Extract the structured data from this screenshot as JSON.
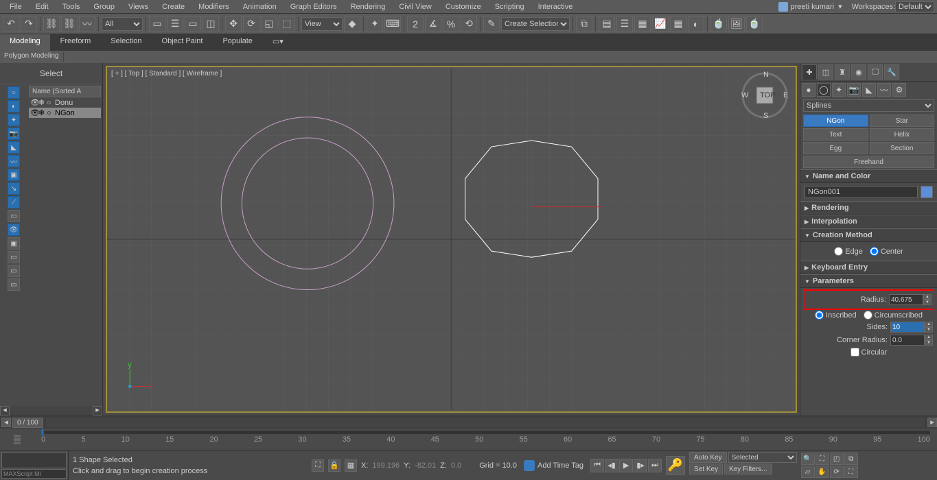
{
  "menu": {
    "items": [
      "File",
      "Edit",
      "Tools",
      "Group",
      "Views",
      "Create",
      "Modifiers",
      "Animation",
      "Graph Editors",
      "Rendering",
      "Civil View",
      "Customize",
      "Scripting",
      "Interactive"
    ],
    "user": "preeti kumari",
    "workspaces_label": "Workspaces:",
    "workspace": "Default"
  },
  "toolbar": {
    "all": "All",
    "view": "View",
    "selset": "Create Selection Se"
  },
  "ribbon": {
    "tabs": [
      "Modeling",
      "Freeform",
      "Selection",
      "Object Paint",
      "Populate"
    ],
    "sub": "Polygon Modeling"
  },
  "scene": {
    "title": "Select",
    "tree_header": "Name (Sorted A",
    "items": [
      {
        "name": "Donu",
        "selected": false
      },
      {
        "name": "NGon",
        "selected": true
      }
    ]
  },
  "viewport": {
    "label": "[ + ] [ Top ] [ Standard ] [ Wireframe ]",
    "compass": {
      "n": "N",
      "s": "S",
      "e": "E",
      "w": "W",
      "face": "TOP"
    }
  },
  "cmd_panel": {
    "category": "Splines",
    "buttons": [
      {
        "label": "NGon",
        "selected": true
      },
      {
        "label": "Star",
        "selected": false
      },
      {
        "label": "Text",
        "selected": false
      },
      {
        "label": "Helix",
        "selected": false
      },
      {
        "label": "Egg",
        "selected": false
      },
      {
        "label": "Section",
        "selected": false
      },
      {
        "label": "Freehand",
        "selected": false
      }
    ],
    "rollouts": {
      "name_color": {
        "title": "Name and Color",
        "name": "NGon001"
      },
      "rendering": {
        "title": "Rendering"
      },
      "interpolation": {
        "title": "Interpolation"
      },
      "creation": {
        "title": "Creation Method",
        "edge": "Edge",
        "center": "Center"
      },
      "keyboard": {
        "title": "Keyboard Entry"
      },
      "params": {
        "title": "Parameters",
        "radius_label": "Radius:",
        "radius": "40.675",
        "inscribed": "Inscribed",
        "circumscribed": "Circumscribed",
        "sides_label": "Sides:",
        "sides": "10",
        "corner_label": "Corner Radius:",
        "corner": "0.0",
        "circular": "Circular"
      }
    }
  },
  "timeline": {
    "slider_label": "0 / 100",
    "ticks": [
      "0",
      "5",
      "10",
      "15",
      "20",
      "25",
      "30",
      "35",
      "40",
      "45",
      "50",
      "55",
      "60",
      "65",
      "70",
      "75",
      "80",
      "85",
      "90",
      "95",
      "100"
    ]
  },
  "status": {
    "script": "MAXScript Mi",
    "msg1": "1 Shape Selected",
    "msg2": "Click and drag to begin creation process",
    "x_label": "X:",
    "x": "199.196",
    "y_label": "Y:",
    "y": "-82.01",
    "z_label": "Z:",
    "z": "0.0",
    "grid": "Grid = 10.0",
    "add_tag": "Add Time Tag",
    "autokey": "Auto Key",
    "selected": "Selected",
    "setkey": "Set Key",
    "keyfilters": "Key Filters..."
  }
}
